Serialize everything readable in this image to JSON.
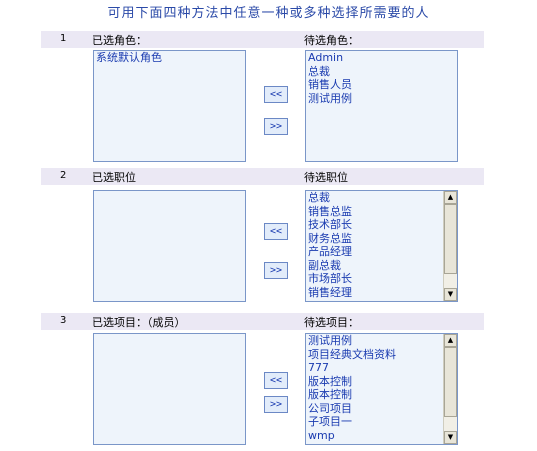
{
  "title": "可用下面四种方法中任意一种或多种选择所需要的人",
  "buttons": {
    "add": "<<",
    "remove": ">>"
  },
  "sections": [
    {
      "num": "1",
      "left_label": "已选角色：",
      "right_label": "待选角色：",
      "selected": [
        "系统默认角色"
      ],
      "available": [
        "Admin",
        "总裁",
        "销售人员",
        "测试用例"
      ]
    },
    {
      "num": "2",
      "left_label": "已选职位",
      "right_label": "待选职位",
      "selected": [],
      "available": [
        "总裁",
        "销售总监",
        "技术部长",
        "财务总监",
        "产品经理",
        "副总裁",
        "市场部长",
        "销售经理"
      ]
    },
    {
      "num": "3",
      "left_label": "已选项目：（成员）",
      "right_label": "待选项目：",
      "selected": [],
      "available": [
        "测试用例",
        "项目经典文档资料",
        "777",
        "版本控制",
        "版本控制",
        "公司项目",
        "子项目一",
        "wmp"
      ]
    }
  ],
  "icons": {
    "scroll_up": "scroll-up-arrow-icon",
    "scroll_down": "scroll-down-arrow-icon"
  }
}
